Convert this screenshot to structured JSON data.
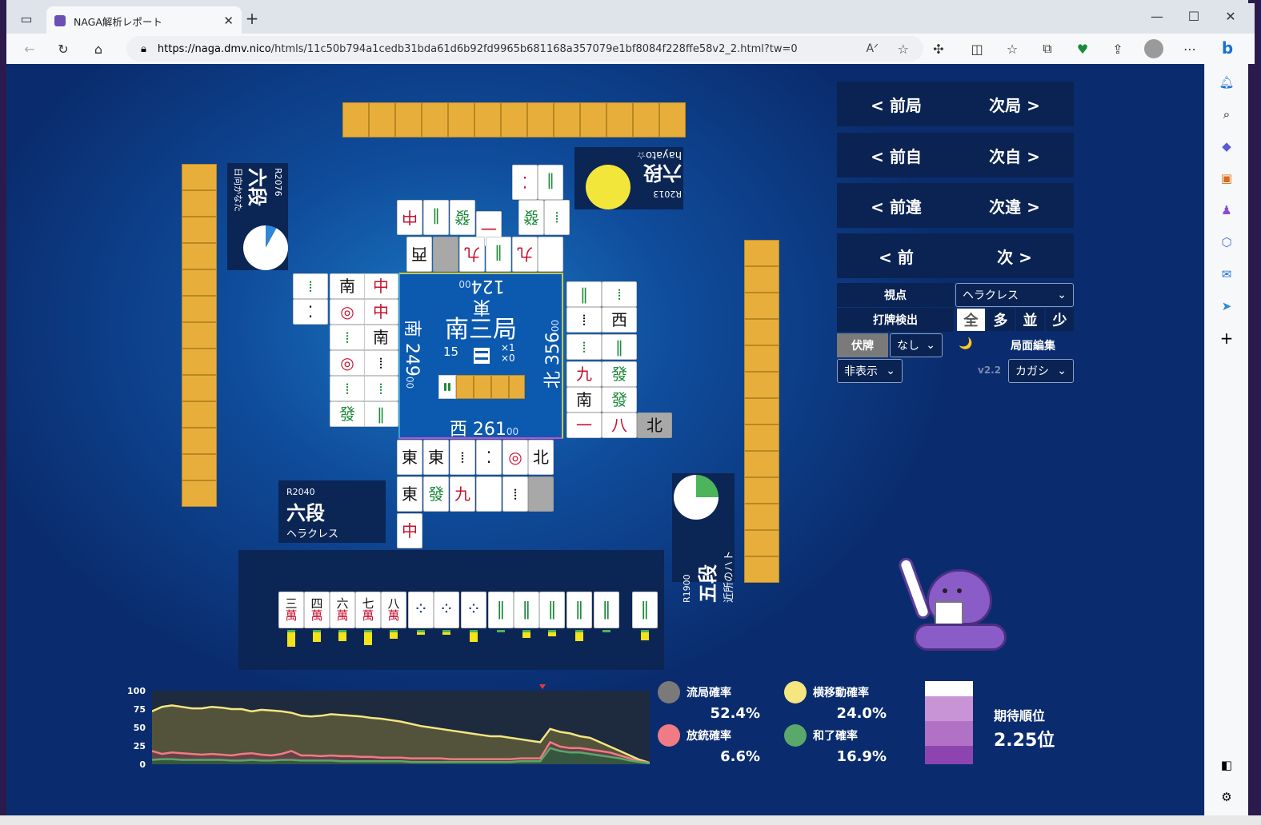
{
  "browser": {
    "tab_title": "NAGA解析レポート",
    "url_host": "https://naga.dmv.nico",
    "url_path": "/htmls/11c50b794a1cedb31bda61d6b92fd9965b681168a357079e1bf8084f228ffe58v2_2.html?tw=0"
  },
  "center": {
    "round": "南三局",
    "honba_count": "15",
    "riichi_x1": "×1",
    "riichi_x0": "×0",
    "east_label": "東",
    "east_score": "124",
    "south_label": "南",
    "south_score": "249",
    "west_label": "西",
    "west_score": "261",
    "north_label": "北",
    "north_score": "356",
    "score_suffix": "00"
  },
  "players": {
    "self": {
      "rating": "R2040",
      "dan": "六段",
      "name": "ヘラクレス"
    },
    "left": {
      "rating": "R2076",
      "dan": "六段",
      "name": "日向かなた"
    },
    "top": {
      "rating": "R2013",
      "dan": "六段",
      "name": "hayato☆"
    },
    "right": {
      "rating": "R1900",
      "dan": "五段",
      "name": "近所のハト"
    }
  },
  "controls": {
    "prev_round": "< 前局",
    "next_round": "次局 >",
    "prev_self": "< 前自",
    "next_self": "次自 >",
    "prev_diff": "< 前違",
    "next_diff": "次違 >",
    "prev": "< 前",
    "next": "次 >",
    "viewpoint_label": "視点",
    "viewpoint_value": "ヘラクレス",
    "detect_label": "打牌検出",
    "detect_options": [
      "全",
      "多",
      "並",
      "少"
    ],
    "hide_label": "伏牌",
    "hide_value": "なし",
    "moon_icon": "🌙",
    "edit_label": "局面編集",
    "display_value": "非表示",
    "version": "v2.2",
    "lang_value": "カガシ"
  },
  "hand": {
    "tiles": [
      "三萬",
      "四萬",
      "六萬",
      "七萬",
      "八萬",
      "7p",
      "7p",
      "9p",
      "3s",
      "6s",
      "7s",
      "8s",
      "9s",
      "9s"
    ],
    "tile_tops": [
      "三",
      "四",
      "六",
      "七",
      "八"
    ],
    "tile_bottom": "萬",
    "bar_levels": [
      0.75,
      0.52,
      0.5,
      0.68,
      0.38,
      0.2,
      0.22,
      0.55,
      0.08,
      0.35,
      0.28,
      0.5,
      0.08,
      0.46
    ],
    "bar_color": "#f5e21b"
  },
  "chart_data": {
    "type": "area",
    "yticks": [
      "100",
      "75",
      "50",
      "25",
      "0"
    ],
    "ylim": [
      0,
      100
    ],
    "series": [
      {
        "color": "#f5e680",
        "values": [
          72,
          78,
          80,
          78,
          76,
          76,
          78,
          77,
          75,
          75,
          72,
          74,
          73,
          72,
          70,
          66,
          65,
          66,
          68,
          67,
          66,
          65,
          63,
          62,
          60,
          58,
          55,
          52,
          50,
          48,
          46,
          44,
          42,
          40,
          38,
          38,
          36,
          34,
          32,
          30,
          48,
          44,
          42,
          38,
          36,
          30,
          24,
          18,
          12,
          6,
          2
        ]
      },
      {
        "color": "#f07b84",
        "values": [
          18,
          14,
          16,
          15,
          14,
          13,
          14,
          13,
          12,
          14,
          15,
          13,
          12,
          14,
          18,
          12,
          12,
          11,
          12,
          11,
          11,
          10,
          10,
          9,
          9,
          9,
          8,
          8,
          8,
          8,
          7,
          7,
          7,
          7,
          7,
          7,
          7,
          8,
          8,
          8,
          30,
          24,
          22,
          22,
          20,
          18,
          16,
          12,
          8,
          4,
          2
        ]
      },
      {
        "color": "#5aa86a",
        "values": [
          6,
          7,
          7,
          6,
          6,
          6,
          6,
          6,
          5,
          5,
          6,
          5,
          5,
          6,
          6,
          5,
          5,
          5,
          5,
          4,
          4,
          4,
          4,
          4,
          4,
          4,
          3,
          3,
          3,
          3,
          3,
          3,
          3,
          3,
          3,
          3,
          3,
          4,
          4,
          4,
          22,
          18,
          16,
          16,
          14,
          12,
          10,
          8,
          5,
          3,
          1
        ]
      }
    ]
  },
  "stats": {
    "draw_label": "流局確率",
    "draw_value": "52.4%",
    "move_label": "横移動確率",
    "move_value": "24.0%",
    "dealin_label": "放銃確率",
    "dealin_value": "6.6%",
    "win_label": "和了確率",
    "win_value": "16.9%",
    "expected_label": "期待順位",
    "expected_value": "2.25位",
    "draw_color": "#7a7a7a",
    "move_color": "#f5e680",
    "dealin_color": "#f07b84",
    "win_color": "#5aa86a",
    "rank_bar_colors": [
      "#ffffff",
      "#c994d6",
      "#b172c6",
      "#8e44b0"
    ]
  },
  "pie": {
    "left_fraction": 0.08,
    "right_fraction": 0.25,
    "left_color": "#2f86d8",
    "right_color": "#4cb45a"
  }
}
